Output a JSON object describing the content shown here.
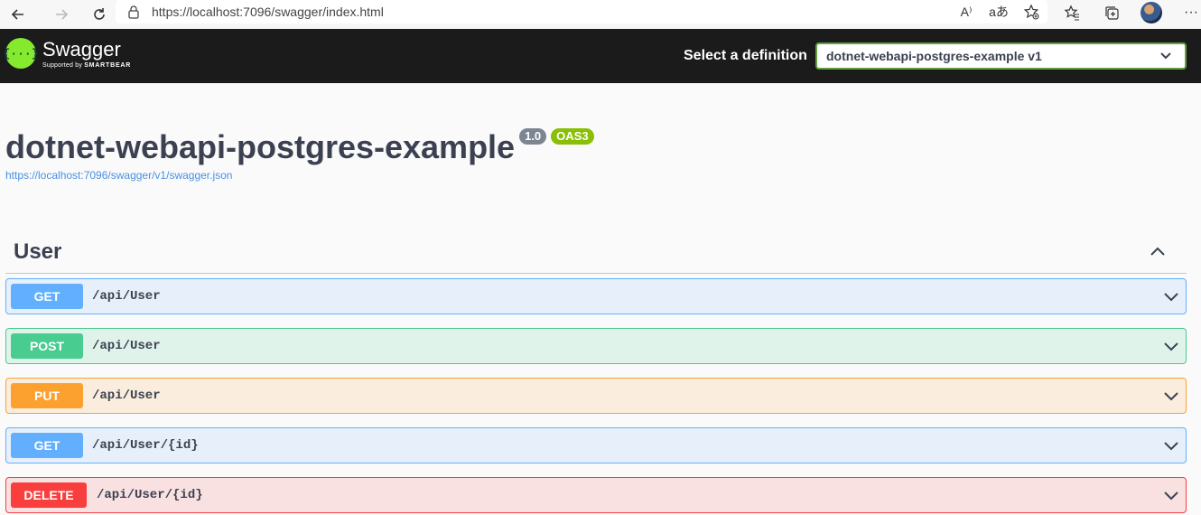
{
  "browser": {
    "url": "https://localhost:7096/swagger/index.html",
    "icons": [
      "back-icon",
      "forward-icon",
      "refresh-icon",
      "lock-icon",
      "read-aloud-icon",
      "translate-icon",
      "favorite-add-icon",
      "favorites-icon",
      "collections-icon",
      "profile-avatar",
      "more-icon"
    ],
    "read_aloud_glyph": "A⁾",
    "translate_glyph": "aあ",
    "more_glyph": "···"
  },
  "topbar": {
    "logo_title": "Swagger",
    "logo_glyph": "{···}",
    "logo_sub_prefix": "Supported by",
    "logo_sub_brand": "SMARTBEAR",
    "definition_label": "Select a definition",
    "definition_selected": "dotnet-webapi-postgres-example v1",
    "brand_color": "#85ea2d"
  },
  "info": {
    "title": "dotnet-webapi-postgres-example",
    "version": "1.0",
    "oas": "OAS3",
    "spec_url": "https://localhost:7096/swagger/v1/swagger.json"
  },
  "tag": {
    "name": "User",
    "expanded": true
  },
  "operations": [
    {
      "method": "GET",
      "path": "/api/User",
      "color": "#61affe"
    },
    {
      "method": "POST",
      "path": "/api/User",
      "color": "#49cc90"
    },
    {
      "method": "PUT",
      "path": "/api/User",
      "color": "#fca130"
    },
    {
      "method": "GET",
      "path": "/api/User/{id}",
      "color": "#61affe"
    },
    {
      "method": "DELETE",
      "path": "/api/User/{id}",
      "color": "#f93e3e"
    }
  ]
}
